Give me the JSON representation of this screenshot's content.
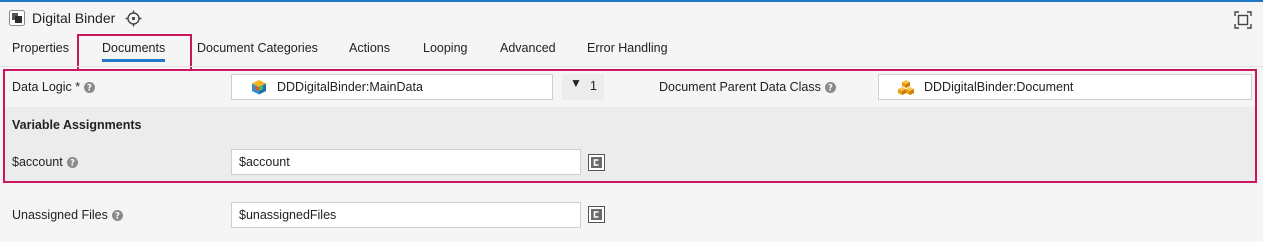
{
  "window": {
    "title": "Digital Binder",
    "app_icon": "digital-binder-icon",
    "locate_icon": "crosshair-icon",
    "maximize_icon": "maximize-icon"
  },
  "tabs": [
    {
      "label": "Properties"
    },
    {
      "label": "Documents",
      "active": true
    },
    {
      "label": "Document Categories"
    },
    {
      "label": "Actions"
    },
    {
      "label": "Looping"
    },
    {
      "label": "Advanced"
    },
    {
      "label": "Error Handling"
    }
  ],
  "form": {
    "data_logic": {
      "label": "Data Logic *",
      "value": "DDDigitalBinder:MainData",
      "count": "1"
    },
    "parent_class": {
      "label": "Document Parent Data Class",
      "value": "DDDigitalBinder:Document"
    },
    "variable_assignments": {
      "heading": "Variable Assignments"
    },
    "account": {
      "label": "$account",
      "value": "$account"
    },
    "unassigned_files": {
      "label": "Unassigned Files",
      "value": "$unassignedFiles"
    }
  },
  "colors": {
    "accent": "#1f78c8",
    "highlight": "#c8165f"
  }
}
